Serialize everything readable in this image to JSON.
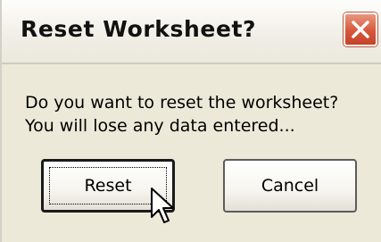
{
  "dialog": {
    "title": "Reset Worksheet?",
    "message_line1": "Do you want to reset the worksheet?",
    "message_line2": "You will lose any data entered...",
    "close_icon": "close-x-icon",
    "buttons": {
      "reset_label": "Reset",
      "cancel_label": "Cancel"
    },
    "default_button": "Reset",
    "cursor_icon": "arrow-pointer-icon",
    "colors": {
      "dialog_background": "#ece9d8",
      "close_button": "#d7573a"
    }
  }
}
